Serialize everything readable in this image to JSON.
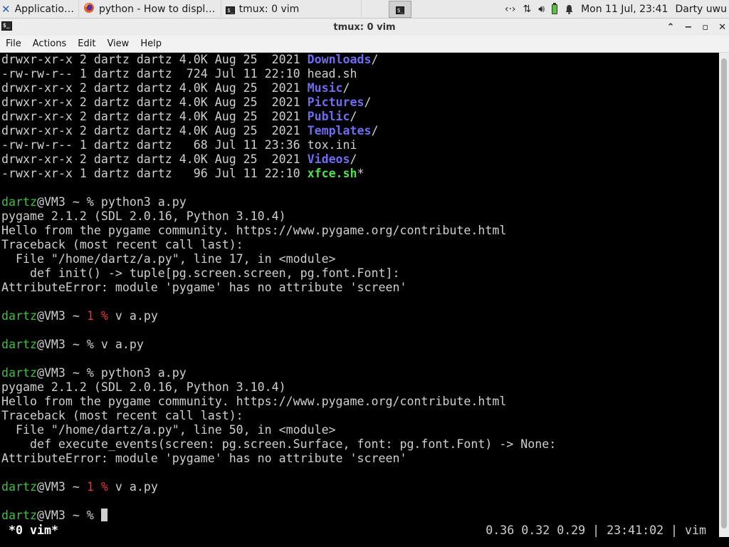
{
  "panel": {
    "applications_label": "Applications",
    "firefox_task_label": "python - How to display...",
    "tmux_task_label": "tmux: 0 vim",
    "datetime": "Mon 11 Jul, 23:41",
    "user": "Darty uwu"
  },
  "window": {
    "title": "tmux: 0 vim"
  },
  "menubar": {
    "file": "File",
    "actions": "Actions",
    "edit": "Edit",
    "view": "View",
    "help": "Help"
  },
  "terminal": {
    "lines": [
      [
        {
          "t": "drwxr-xr-x 2 dartz dartz 4.0K Aug 25  2021 "
        },
        {
          "t": "Downloads",
          "c": "c-dir"
        },
        {
          "t": "/"
        }
      ],
      [
        {
          "t": "-rw-rw-r-- 1 dartz dartz  724 Jul 11 22:10 head.sh"
        }
      ],
      [
        {
          "t": "drwxr-xr-x 2 dartz dartz 4.0K Aug 25  2021 "
        },
        {
          "t": "Music",
          "c": "c-dir"
        },
        {
          "t": "/"
        }
      ],
      [
        {
          "t": "drwxr-xr-x 2 dartz dartz 4.0K Aug 25  2021 "
        },
        {
          "t": "Pictures",
          "c": "c-dir"
        },
        {
          "t": "/"
        }
      ],
      [
        {
          "t": "drwxr-xr-x 2 dartz dartz 4.0K Aug 25  2021 "
        },
        {
          "t": "Public",
          "c": "c-dir"
        },
        {
          "t": "/"
        }
      ],
      [
        {
          "t": "drwxr-xr-x 2 dartz dartz 4.0K Aug 25  2021 "
        },
        {
          "t": "Templates",
          "c": "c-dir"
        },
        {
          "t": "/"
        }
      ],
      [
        {
          "t": "-rw-rw-r-- 1 dartz dartz   68 Jul 11 23:36 tox.ini"
        }
      ],
      [
        {
          "t": "drwxr-xr-x 2 dartz dartz 4.0K Aug 25  2021 "
        },
        {
          "t": "Videos",
          "c": "c-dir"
        },
        {
          "t": "/"
        }
      ],
      [
        {
          "t": "-rwxr-xr-x 1 dartz dartz   96 Jul 11 22:10 "
        },
        {
          "t": "xfce.sh",
          "c": "c-exe"
        },
        {
          "t": "*"
        }
      ],
      [
        {
          "t": ""
        }
      ],
      [
        {
          "t": "dartz",
          "c": "c-user"
        },
        {
          "t": "@VM3 ~ % python3 a.py"
        }
      ],
      [
        {
          "t": "pygame 2.1.2 (SDL 2.0.16, Python 3.10.4)"
        }
      ],
      [
        {
          "t": "Hello from the pygame community. https://www.pygame.org/contribute.html"
        }
      ],
      [
        {
          "t": "Traceback (most recent call last):"
        }
      ],
      [
        {
          "t": "  File \"/home/dartz/a.py\", line 17, in <module>"
        }
      ],
      [
        {
          "t": "    def init() -> tuple[pg.screen.screen, pg.font.Font]:"
        }
      ],
      [
        {
          "t": "AttributeError: module 'pygame' has no attribute 'screen'"
        }
      ],
      [
        {
          "t": ""
        }
      ],
      [
        {
          "t": "dartz",
          "c": "c-user"
        },
        {
          "t": "@VM3 ~ "
        },
        {
          "t": "1 %",
          "c": "c-err"
        },
        {
          "t": " v a.py"
        }
      ],
      [
        {
          "t": ""
        }
      ],
      [
        {
          "t": "dartz",
          "c": "c-user"
        },
        {
          "t": "@VM3 ~ % v a.py"
        }
      ],
      [
        {
          "t": ""
        }
      ],
      [
        {
          "t": "dartz",
          "c": "c-user"
        },
        {
          "t": "@VM3 ~ % python3 a.py"
        }
      ],
      [
        {
          "t": "pygame 2.1.2 (SDL 2.0.16, Python 3.10.4)"
        }
      ],
      [
        {
          "t": "Hello from the pygame community. https://www.pygame.org/contribute.html"
        }
      ],
      [
        {
          "t": "Traceback (most recent call last):"
        }
      ],
      [
        {
          "t": "  File \"/home/dartz/a.py\", line 50, in <module>"
        }
      ],
      [
        {
          "t": "    def execute_events(screen: pg.screen.Surface, font: pg.font.Font) -> None:"
        }
      ],
      [
        {
          "t": "AttributeError: module 'pygame' has no attribute 'screen'"
        }
      ],
      [
        {
          "t": ""
        }
      ],
      [
        {
          "t": "dartz",
          "c": "c-user"
        },
        {
          "t": "@VM3 ~ "
        },
        {
          "t": "1 %",
          "c": "c-err"
        },
        {
          "t": " v a.py"
        }
      ],
      [
        {
          "t": ""
        }
      ],
      [
        {
          "t": "dartz",
          "c": "c-user"
        },
        {
          "t": "@VM3 ~ % "
        },
        {
          "cursor": true
        }
      ]
    ]
  },
  "status": {
    "left": "*0 vim*",
    "right": "0.36 0.32 0.29 | 23:41:02 | vim"
  },
  "colors": {
    "user": "#3fbf3f",
    "error": "#e03b3b",
    "directory": "#6f6cf0",
    "executable": "#4fe04f",
    "text": "#cfcfcf",
    "background": "#000000"
  },
  "icons": {
    "xfce": "xfce-mouse-icon",
    "firefox": "firefox-icon",
    "terminal": "terminal-icon",
    "network": "network-icon",
    "transfer": "up-down-arrows-icon",
    "volume": "speaker-icon",
    "battery": "battery-icon",
    "notification": "bell-icon"
  }
}
